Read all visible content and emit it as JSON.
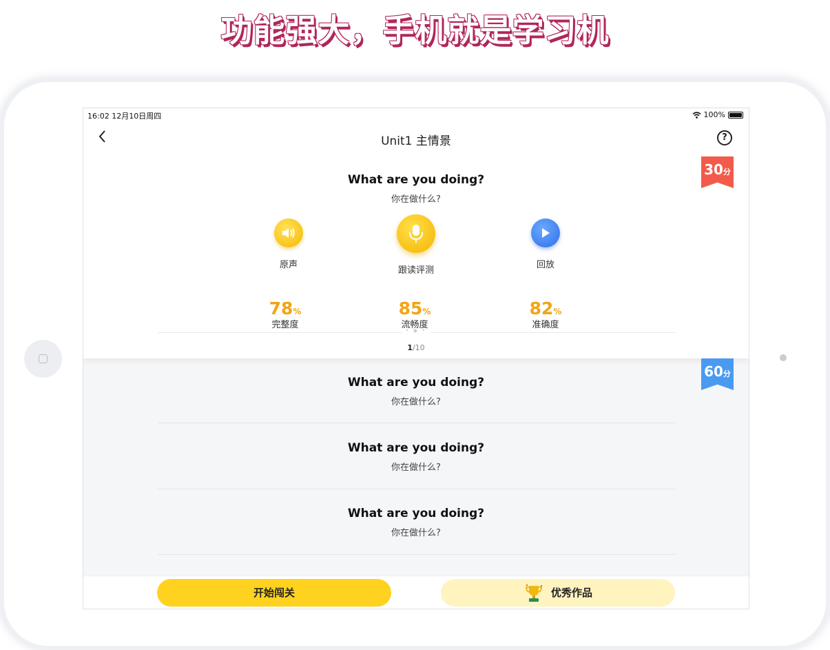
{
  "headline": "功能强大，手机就是学习机",
  "statusbar": {
    "time_date": "16:02   12月10日周四",
    "battery": "100%"
  },
  "navbar": {
    "back_icon": "<",
    "title": "Unit1 主情景",
    "help_icon": "?"
  },
  "active_sentence": {
    "en": "What are you doing?",
    "cn": "你在做什么?",
    "score_badge": {
      "value": "30",
      "unit": "分",
      "color": "#f25b4b"
    },
    "controls": {
      "original": "原声",
      "record": "跟读评测",
      "playback": "回放"
    },
    "dots": "• ◆ •",
    "scores": [
      {
        "value": "78",
        "unit": "%",
        "label": "完整度"
      },
      {
        "value": "85",
        "unit": "%",
        "label": "流畅度"
      },
      {
        "value": "82",
        "unit": "%",
        "label": "准确度"
      }
    ],
    "pager": {
      "current": "1",
      "total": "/10"
    }
  },
  "sentences": [
    {
      "en": "What are you doing?",
      "cn": "你在做什么?"
    },
    {
      "en": "What are you doing?",
      "cn": "你在做什么?"
    },
    {
      "en": "What are you doing?",
      "cn": "你在做什么?"
    }
  ],
  "second_badge": {
    "value": "60",
    "unit": "分",
    "color": "#4a9af2"
  },
  "footer": {
    "start_label": "开始闯关",
    "works_label": "优秀作品"
  },
  "colors": {
    "accent_yellow": "#ffd21f",
    "score_orange": "#f2a414",
    "play_blue": "#3d82ef"
  }
}
